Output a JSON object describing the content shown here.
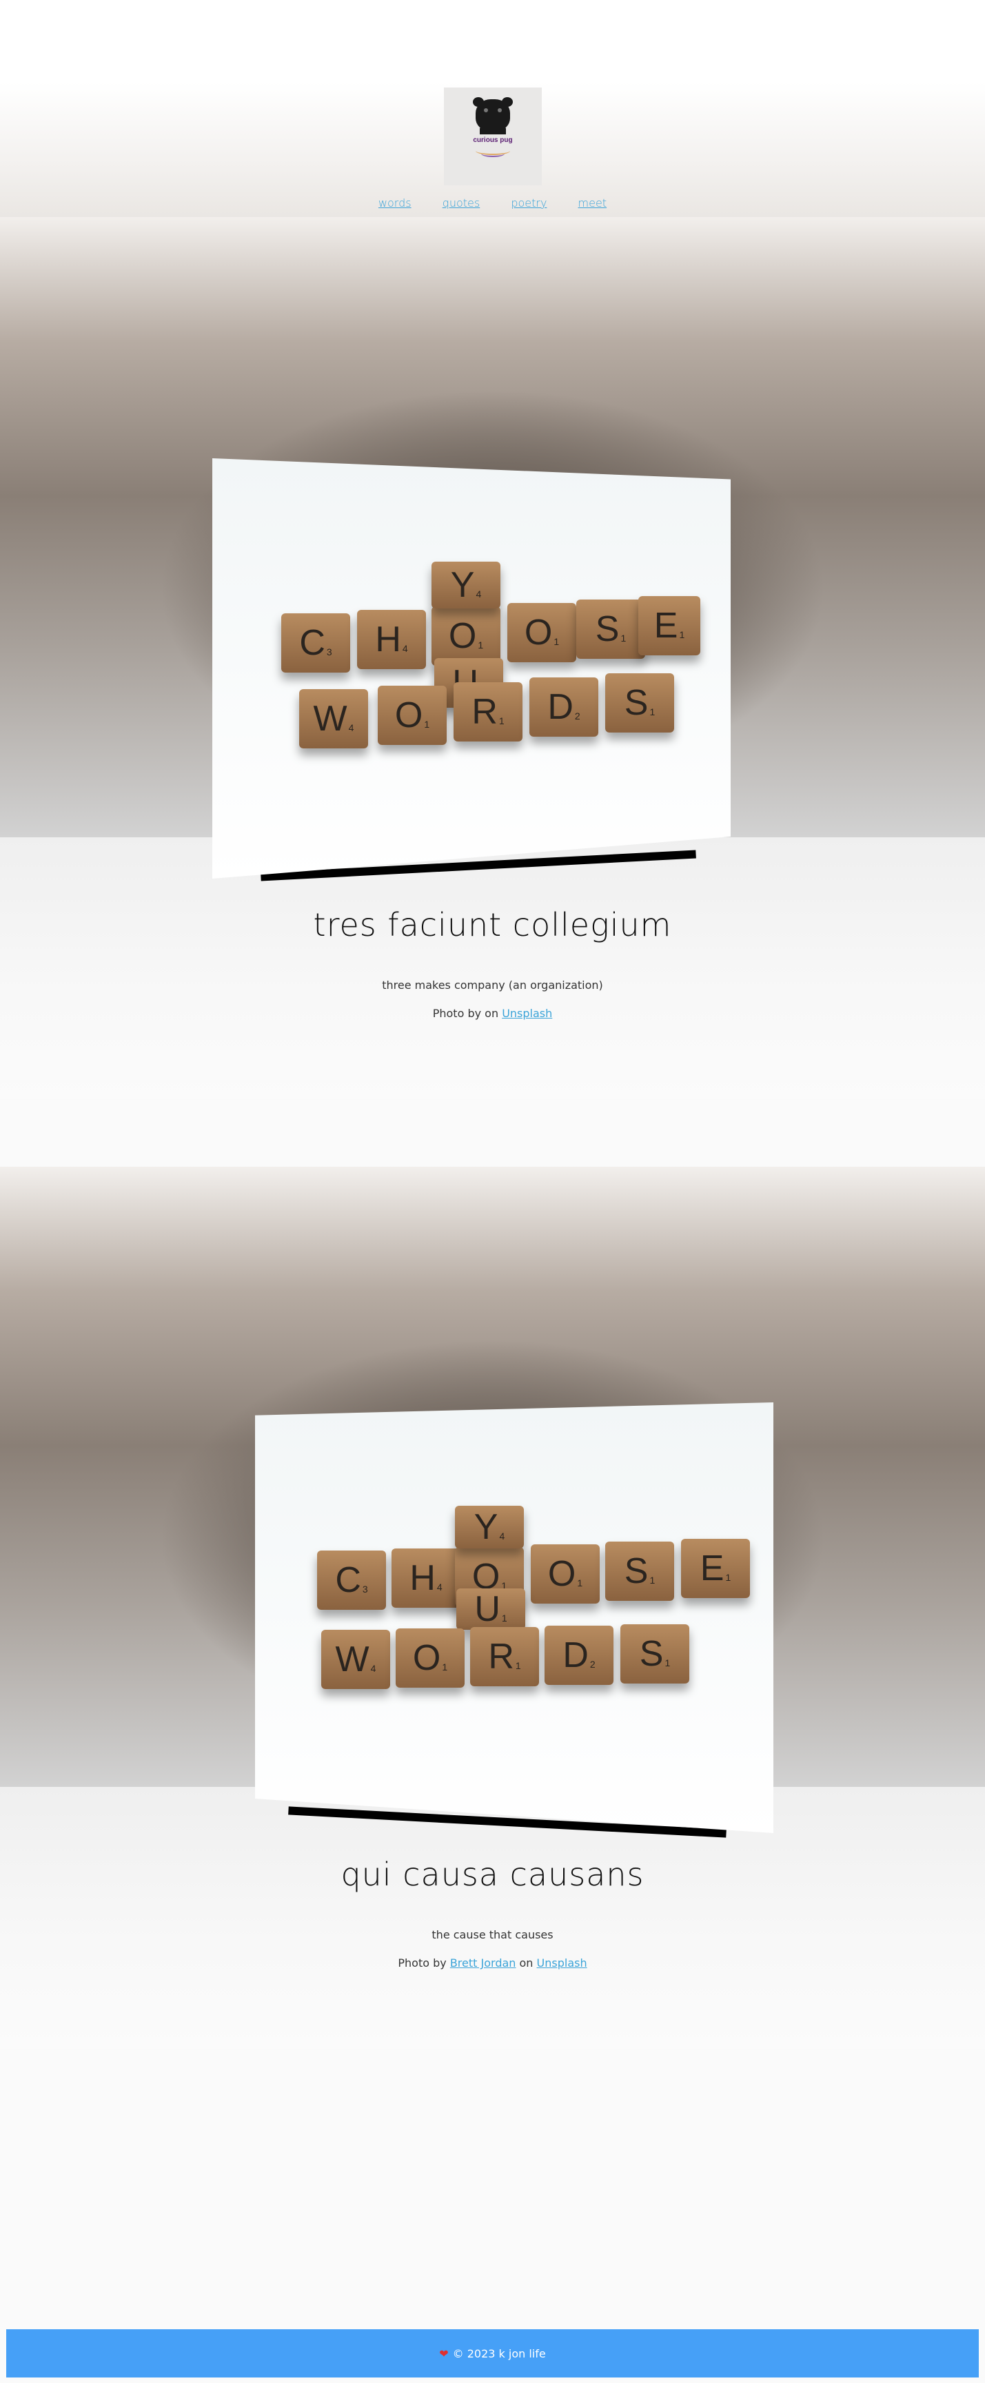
{
  "logo": {
    "text": "curious pug"
  },
  "nav": [
    {
      "label": "words"
    },
    {
      "label": "quotes"
    },
    {
      "label": "poetry"
    },
    {
      "label": "meet"
    }
  ],
  "tiles": {
    "row1": [
      "C",
      "H",
      "O",
      "O",
      "S",
      "E"
    ],
    "row1_sub": [
      "3",
      "4",
      "1",
      "1",
      "1",
      "1"
    ],
    "col": [
      "Y",
      "O",
      "U"
    ],
    "col_sub": [
      "4",
      "1",
      "1"
    ],
    "row2": [
      "W",
      "O",
      "R",
      "D",
      "S"
    ],
    "row2_sub": [
      "4",
      "1",
      "1",
      "2",
      "1"
    ]
  },
  "sections": [
    {
      "title": "tres faciunt collegium",
      "subtitle": "three makes company (an organization)",
      "credit_prefix": "Photo by",
      "credit_author": "",
      "credit_middle": "on",
      "credit_site": "Unsplash"
    },
    {
      "title": "qui causa causans",
      "subtitle": "the cause that causes",
      "credit_prefix": "Photo by",
      "credit_author": "Brett Jordan",
      "credit_middle": "on",
      "credit_site": "Unsplash"
    }
  ],
  "footer": {
    "heart": "❤",
    "text": "© 2023 k jon life"
  }
}
